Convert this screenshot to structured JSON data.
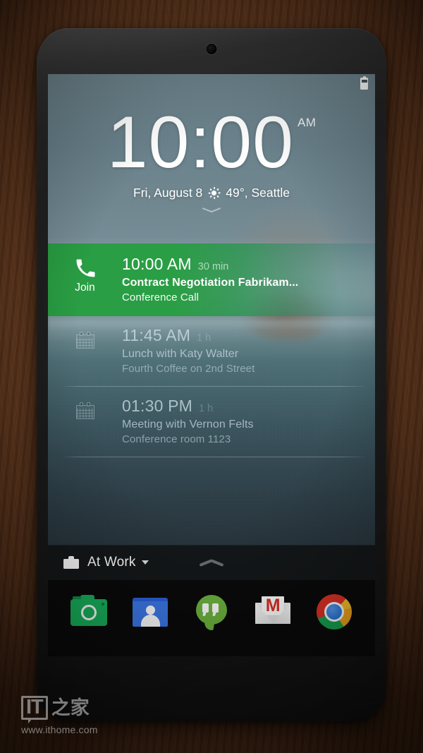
{
  "statusbar": {
    "battery_icon": "battery-icon"
  },
  "lockscreen": {
    "time": "10:00",
    "ampm": "AM",
    "date": "Fri, August 8",
    "weather_icon": "sun-icon",
    "temperature": "49°",
    "location": "Seattle",
    "date_line": "Fri, August 8",
    "weather_line": "49°, Seattle",
    "expand_icon": "chevron-down-icon"
  },
  "agenda": {
    "events": [
      {
        "state": "active",
        "icon": "phone-icon",
        "action_label": "Join",
        "time": "10:00 AM",
        "duration": "30 min",
        "title": "Contract Negotiation Fabrikam...",
        "subtitle": "Conference Call"
      },
      {
        "state": "dim",
        "icon": "calendar-icon",
        "time": "11:45 AM",
        "duration": "1 h",
        "title": "Lunch with Katy Walter",
        "subtitle": "Fourth Coffee on 2nd Street"
      },
      {
        "state": "dim",
        "icon": "calendar-icon",
        "time": "01:30 PM",
        "duration": "1 h",
        "title": "Meeting with Vernon Felts",
        "subtitle": "Conference room 1123"
      }
    ]
  },
  "bottombar": {
    "mode_icon": "briefcase-icon",
    "mode_label": "At Work",
    "mode_caret_icon": "caret-down-icon",
    "drawer_icon": "chevron-up-icon"
  },
  "dock": {
    "apps": [
      {
        "name": "camera-app",
        "icon": "camera-icon"
      },
      {
        "name": "contacts-app",
        "icon": "people-icon"
      },
      {
        "name": "hangouts-app",
        "icon": "hangouts-icon"
      },
      {
        "name": "gmail-app",
        "icon": "gmail-icon",
        "glyph": "M"
      },
      {
        "name": "chrome-app",
        "icon": "chrome-icon"
      }
    ]
  },
  "watermark": {
    "logo_latin": "IT",
    "logo_cn": "之家",
    "url": "www.ithome.com"
  },
  "colors": {
    "accent_green": "#269e40",
    "dock_background": "#0a0a0a",
    "bottombar_background": "#141719",
    "text_primary": "#ffffff"
  }
}
